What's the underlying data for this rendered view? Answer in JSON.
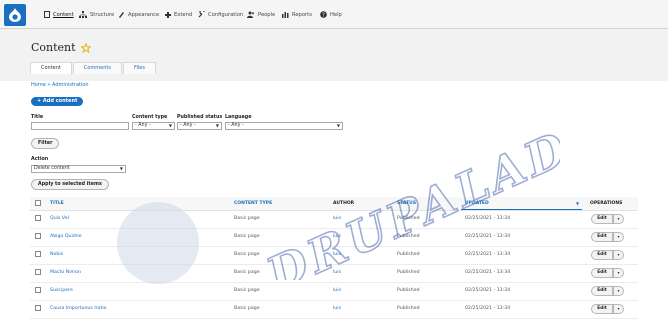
{
  "toolbar": {
    "items": [
      {
        "label": "Content",
        "icon": "content-icon"
      },
      {
        "label": "Structure",
        "icon": "structure-icon"
      },
      {
        "label": "Appearance",
        "icon": "appearance-icon"
      },
      {
        "label": "Extend",
        "icon": "extend-icon"
      },
      {
        "label": "Configuration",
        "icon": "configuration-icon"
      },
      {
        "label": "People",
        "icon": "people-icon"
      },
      {
        "label": "Reports",
        "icon": "reports-icon"
      },
      {
        "label": "Help",
        "icon": "help-icon"
      }
    ],
    "active": "Content"
  },
  "page": {
    "title": "Content",
    "tabs": [
      "Content",
      "Comments",
      "Files"
    ],
    "active_tab": "Content",
    "breadcrumb": "Home » Administration"
  },
  "actions": {
    "add_content": "+ Add content"
  },
  "filters": {
    "title_label": "Title",
    "title_value": "",
    "content_type_label": "Content type",
    "content_type_value": "- Any -",
    "published_label": "Published status",
    "published_value": "- Any -",
    "language_label": "Language",
    "language_value": "- Any -",
    "filter_button": "Filter"
  },
  "bulk": {
    "action_label": "Action",
    "action_value": "Delete content",
    "apply_button": "Apply to selected items"
  },
  "table": {
    "columns": [
      "TITLE",
      "CONTENT TYPE",
      "AUTHOR",
      "STATUS",
      "UPDATED",
      "OPERATIONS"
    ],
    "sorted_column": "UPDATED",
    "rows": [
      {
        "title": "Quis Vel",
        "type": "Basic page",
        "author": "luis",
        "status": "Published",
        "updated": "02/25/2021 - 13:34"
      },
      {
        "title": "Abigo Quidne",
        "type": "Basic page",
        "author": "luis",
        "status": "Published",
        "updated": "02/25/2021 - 13:34"
      },
      {
        "title": "Nobis",
        "type": "Basic page",
        "author": "luis",
        "status": "Published",
        "updated": "02/25/2021 - 13:34"
      },
      {
        "title": "Macto Nimon",
        "type": "Basic page",
        "author": "luis",
        "status": "Published",
        "updated": "02/25/2021 - 13:34"
      },
      {
        "title": "Suscipere",
        "type": "Basic page",
        "author": "luis",
        "status": "Published",
        "updated": "02/25/2021 - 13:34"
      },
      {
        "title": "Causa Importunus Iratio",
        "type": "Basic page",
        "author": "luis",
        "status": "Published",
        "updated": "02/25/2021 - 13:34"
      }
    ],
    "edit_label": "Edit",
    "dropdown_glyph": "▾"
  },
  "watermark": {
    "text": "DRUPALADICTO"
  },
  "colors": {
    "brand": "#1b6fc1",
    "link": "#1d6fb8",
    "watermark": "#3f5ea8"
  }
}
